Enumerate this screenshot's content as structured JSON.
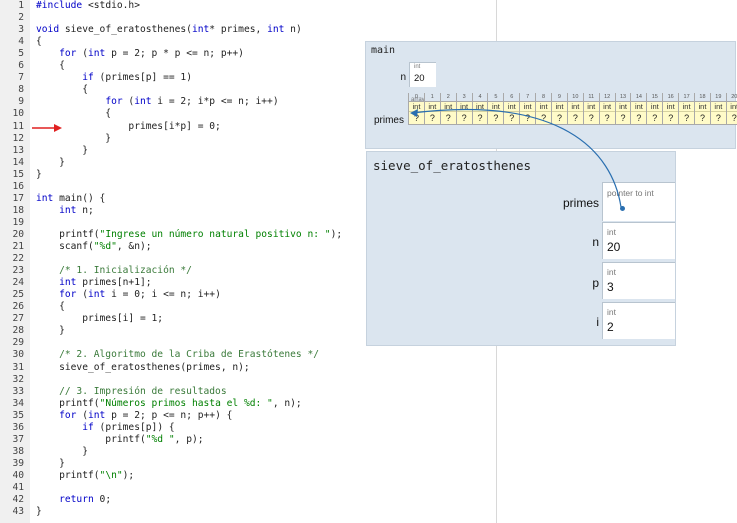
{
  "editor": {
    "lines": [
      "#include <stdio.h>",
      "",
      "void sieve_of_eratosthenes(int* primes, int n)",
      "{",
      "    for (int p = 2; p * p <= n; p++)",
      "    {",
      "        if (primes[p] == 1)",
      "        {",
      "            for (int i = 2; i*p <= n; i++)",
      "            {",
      "                primes[i*p] = 0;",
      "            }",
      "        }",
      "    }",
      "}",
      "",
      "int main() {",
      "    int n;",
      "",
      "    printf(\"Ingrese un número natural positivo n: \");",
      "    scanf(\"%d\", &n);",
      "",
      "    /* 1. Inicialización */",
      "    int primes[n+1];",
      "    for (int i = 0; i <= n; i++)",
      "    {",
      "        primes[i] = 1;",
      "    }",
      "",
      "    /* 2. Algoritmo de la Criba de Erastótenes */",
      "    sieve_of_eratosthenes(primes, n);",
      "",
      "    // 3. Impresión de resultados",
      "    printf(\"Números primos hasta el %d: \", n);",
      "    for (int p = 2; p <= n; p++) {",
      "        if (primes[p]) {",
      "            printf(\"%d \", p);",
      "        }",
      "    }",
      "    printf(\"\\n\");",
      "",
      "    return 0;",
      "}"
    ],
    "current_line": 11,
    "arrow_color": "#e02020"
  },
  "main_frame": {
    "title": "main",
    "n": {
      "label": "n",
      "type": "int",
      "value": "20"
    },
    "primes": {
      "label": "primes",
      "type_label": "array",
      "indices": [
        "0",
        "1",
        "2",
        "3",
        "4",
        "5",
        "6",
        "7",
        "8",
        "9",
        "10",
        "11",
        "12",
        "13",
        "14",
        "15",
        "16",
        "17",
        "18",
        "19",
        "20"
      ],
      "cell_type": "int",
      "values": [
        "?",
        "?",
        "?",
        "?",
        "?",
        "?",
        "?",
        "?",
        "?",
        "?",
        "?",
        "?",
        "?",
        "?",
        "?",
        "?",
        "?",
        "?",
        "?",
        "?",
        "?"
      ]
    }
  },
  "sieve_frame": {
    "title": "sieve_of_eratosthenes",
    "vars": [
      {
        "name": "primes",
        "type": "pointer to int",
        "value": ""
      },
      {
        "name": "n",
        "type": "int",
        "value": "20"
      },
      {
        "name": "p",
        "type": "int",
        "value": "3"
      },
      {
        "name": "i",
        "type": "int",
        "value": "2"
      }
    ]
  },
  "colors": {
    "frame_bg": "#dbe5ef",
    "cell_bg": "#fffbc8",
    "pointer": "#2a6fb0"
  }
}
